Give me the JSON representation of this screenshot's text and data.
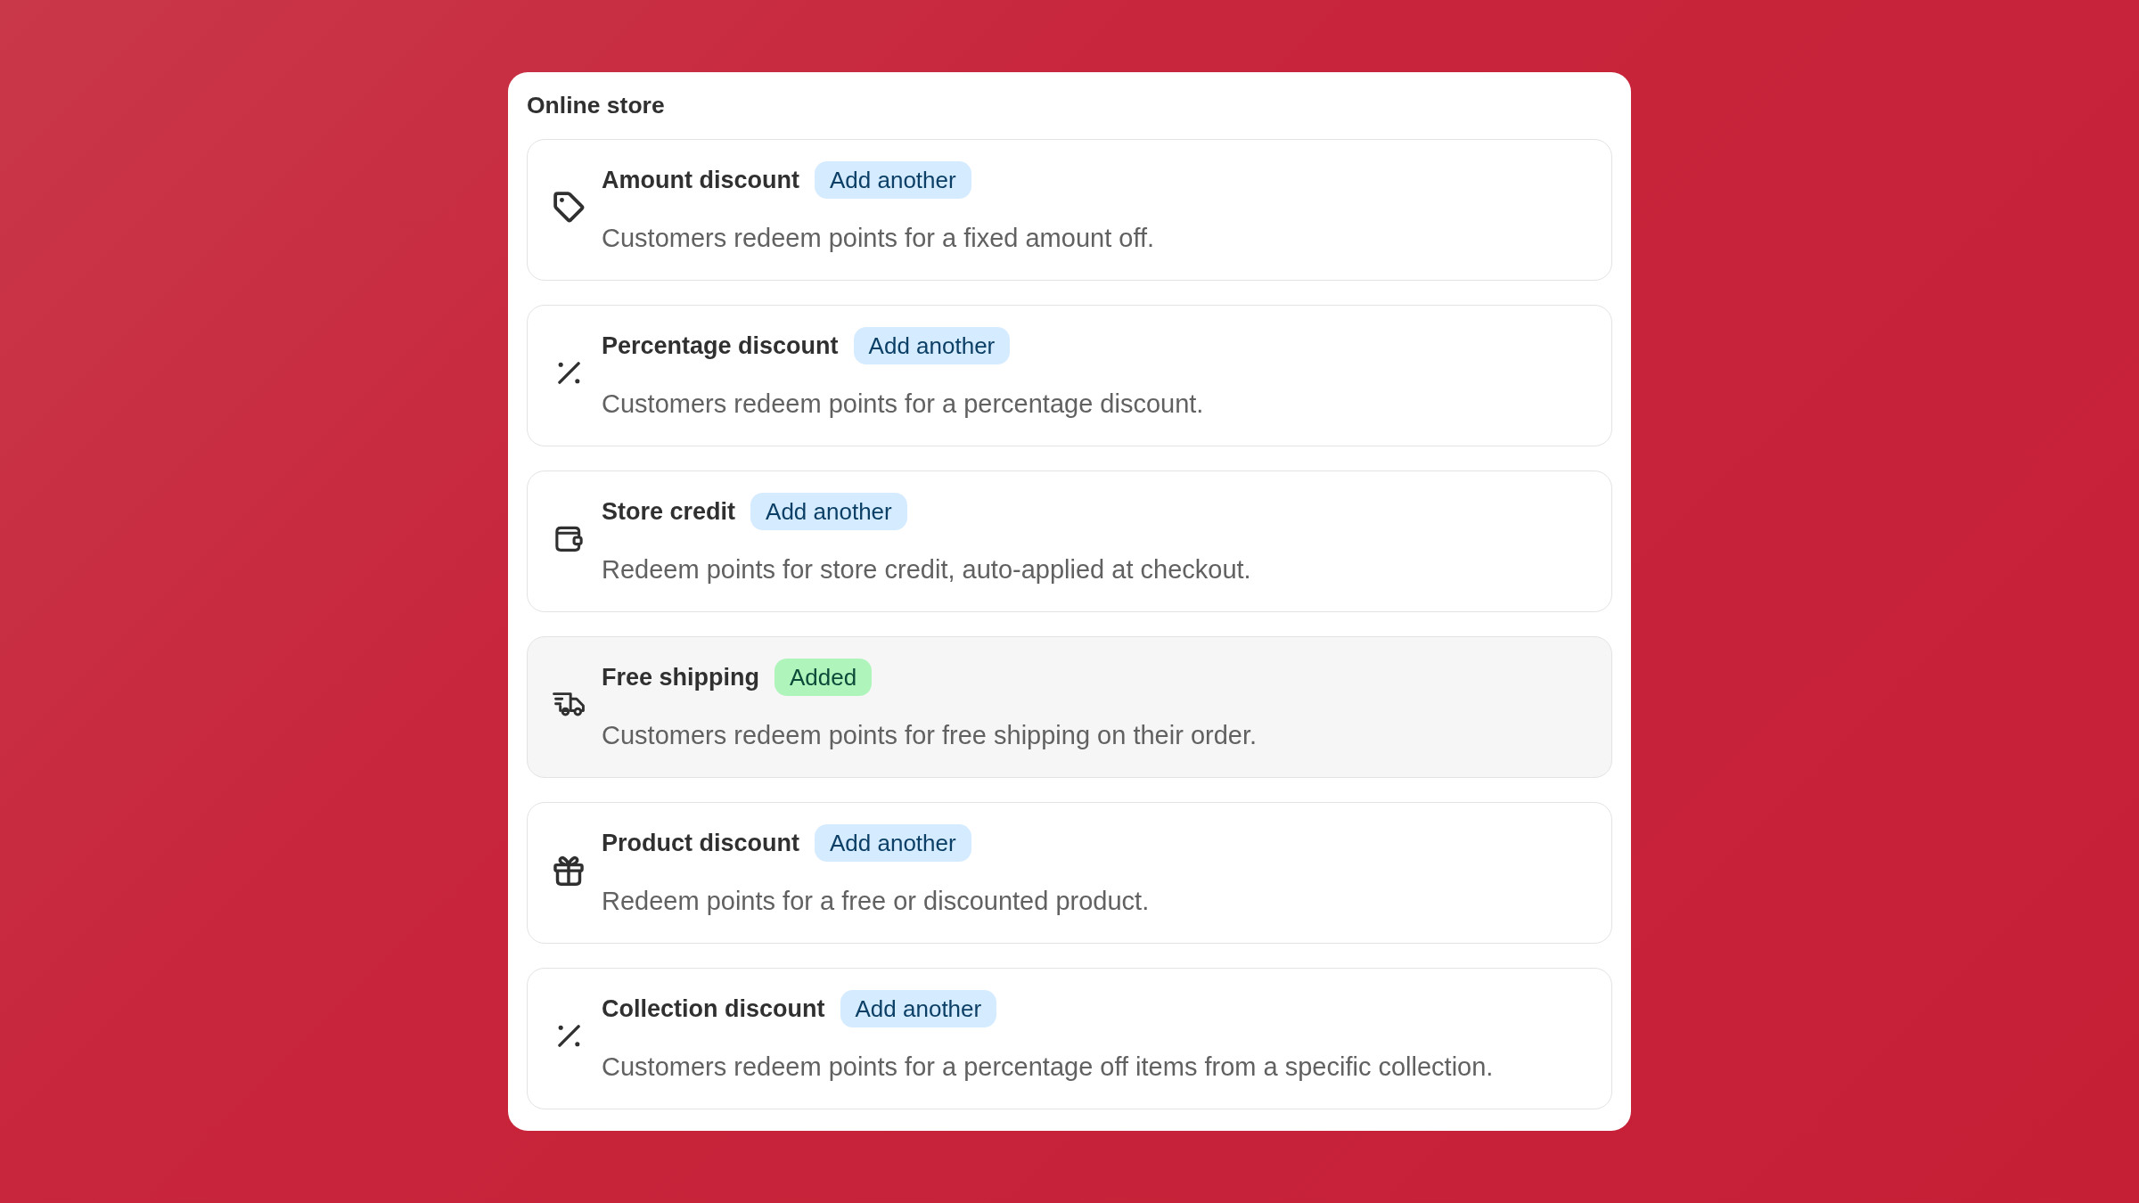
{
  "panel": {
    "title": "Online store"
  },
  "options": [
    {
      "kind": "amount",
      "title": "Amount discount",
      "badge": "Add another",
      "added": false,
      "description": "Customers redeem points for a fixed amount off."
    },
    {
      "kind": "percentage",
      "title": "Percentage discount",
      "badge": "Add another",
      "added": false,
      "description": "Customers redeem points for a percentage discount."
    },
    {
      "kind": "credit",
      "title": "Store credit",
      "badge": "Add another",
      "added": false,
      "description": "Redeem points for store credit, auto-applied at checkout."
    },
    {
      "kind": "shipping",
      "title": "Free shipping",
      "badge": "Added",
      "added": true,
      "description": "Customers redeem points for free shipping on their order."
    },
    {
      "kind": "product",
      "title": "Product discount",
      "badge": "Add another",
      "added": false,
      "description": "Redeem points for a free or discounted product."
    },
    {
      "kind": "collection",
      "title": "Collection discount",
      "badge": "Add another",
      "added": false,
      "description": "Customers redeem points for a percentage off items from a specific collection."
    }
  ]
}
